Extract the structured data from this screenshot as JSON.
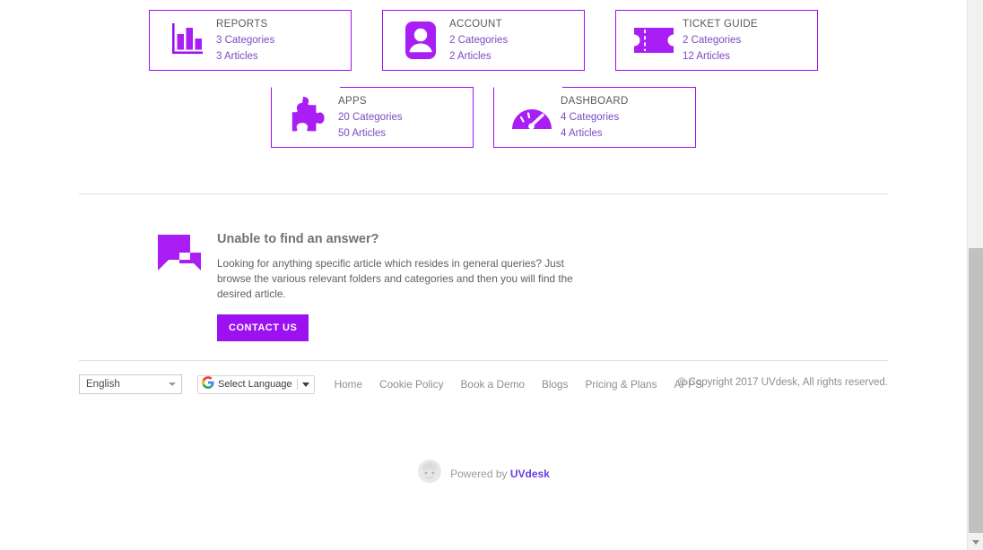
{
  "theme": {
    "purple": "#9b11f0",
    "count_text": "#7d49c4",
    "title_text": "#555a5e",
    "muted_text": "#8a8f94",
    "divider": "#dedede"
  },
  "categories": [
    {
      "icon": "bar-chart-icon",
      "title": "REPORTS",
      "categories": "3 Categories",
      "articles": "3 Articles"
    },
    {
      "icon": "account-icon",
      "title": "ACCOUNT",
      "categories": "2 Categories",
      "articles": "2 Articles"
    },
    {
      "icon": "ticket-icon",
      "title": "TICKET GUIDE",
      "categories": "2 Categories",
      "articles": "12 Articles"
    },
    {
      "icon": "puzzle-piece-icon",
      "title": "APPS",
      "categories": "20 Categories",
      "articles": "50 Articles"
    },
    {
      "icon": "gauge-icon",
      "title": "DASHBOARD",
      "categories": "4 Categories",
      "articles": "4 Articles"
    }
  ],
  "help": {
    "icon": "chat-bubbles-icon",
    "title": "Unable to find an answer?",
    "description": "Looking for anything specific article which resides in general queries? Just browse the various relevant folders and categories and then you will find the desired article.",
    "button_label": "CONTACT US"
  },
  "footer": {
    "language_select": {
      "value": "English",
      "icon": "chevron-down-icon"
    },
    "google_translate": {
      "brand_icon": "google-g-icon",
      "label": "Select Language",
      "caret_icon": "caret-down-icon"
    },
    "links": [
      {
        "label": "Home"
      },
      {
        "label": "Cookie Policy"
      },
      {
        "label": "Book a Demo"
      },
      {
        "label": "Blogs"
      },
      {
        "label": "Pricing & Plans"
      },
      {
        "label": "APPS"
      }
    ],
    "copyright": "© Copyright 2017 UVdesk, All rights reserved."
  },
  "powered_by": {
    "avatar_icon": "uvdesk-face-avatar-icon",
    "prefix": "Powered by ",
    "brand": "UVdesk"
  },
  "scrollbar": {
    "down_arrow_icon": "scroll-down-arrow-icon"
  }
}
